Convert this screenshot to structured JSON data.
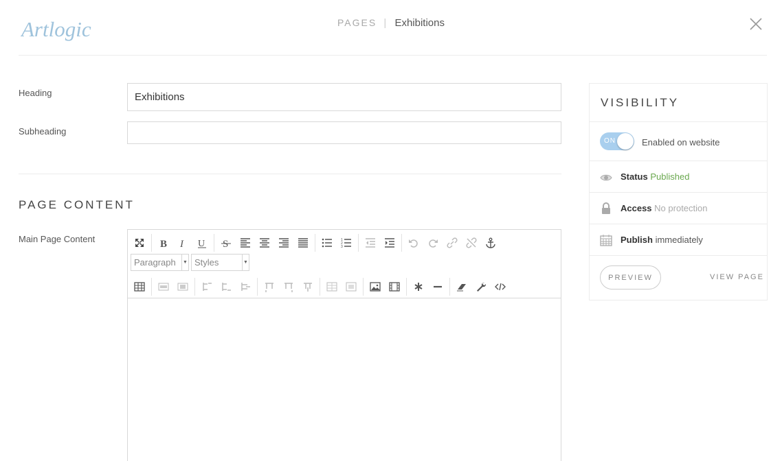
{
  "header": {
    "logo_text": "Artlogic",
    "breadcrumb_root": "PAGES",
    "breadcrumb_separator": "|",
    "breadcrumb_current": "Exhibitions"
  },
  "form": {
    "heading_label": "Heading",
    "heading_value": "Exhibitions",
    "subheading_label": "Subheading",
    "subheading_value": ""
  },
  "page_content": {
    "title": "PAGE CONTENT",
    "main_label": "Main Page Content",
    "format_select": "Paragraph",
    "styles_select": "Styles",
    "toolbar_icons_row1": [
      "fullscreen-icon",
      "bold-icon",
      "italic-icon",
      "underline-icon",
      "strikethrough-icon",
      "align-left-icon",
      "align-center-icon",
      "align-right-icon",
      "justify-icon",
      "bullet-list-icon",
      "numbered-list-icon",
      "outdent-icon",
      "indent-icon",
      "undo-icon",
      "redo-icon",
      "link-icon",
      "unlink-icon",
      "anchor-icon"
    ],
    "toolbar_icons_row3": [
      "table-icon",
      "cell-props-icon",
      "row-props-icon",
      "insert-row-before-icon",
      "insert-row-after-icon",
      "delete-row-icon",
      "insert-col-before-icon",
      "insert-col-after-icon",
      "delete-col-icon",
      "split-cells-icon",
      "merge-cells-icon",
      "image-icon",
      "media-icon",
      "special-char-icon",
      "horizontal-rule-icon",
      "remove-format-icon",
      "settings-wrench-icon",
      "code-icon"
    ]
  },
  "visibility": {
    "title": "VISIBILITY",
    "toggle_text": "ON",
    "enabled_label": "Enabled on website",
    "status_key": "Status",
    "status_value": "Published",
    "access_key": "Access",
    "access_value": "No protection",
    "publish_key": "Publish",
    "publish_value": "immediately",
    "preview_label": "PREVIEW",
    "view_page_label": "VIEW PAGE"
  },
  "colors": {
    "toggle_on": "#a9cfee",
    "status_published": "#6aa84f",
    "logo": "#9fc3dc"
  }
}
